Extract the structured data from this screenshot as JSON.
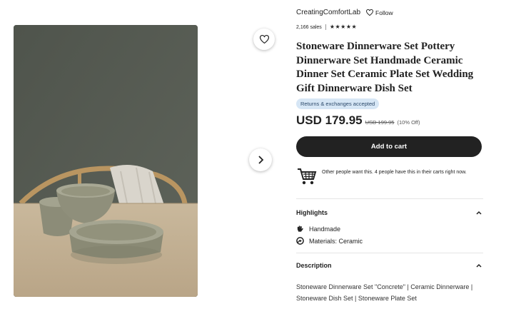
{
  "shop": {
    "name": "CreatingComfortLab",
    "follow_label": "Follow",
    "sales": "2,166 sales",
    "stars": "★★★★★"
  },
  "product": {
    "title": "Stoneware Dinnerware Set Pottery Dinnerware Set Handmade Ceramic Dinner Set Ceramic Plate Set Wedding Gift Dinnerware Dish Set",
    "badge": "Returns & exchanges accepted",
    "price": "USD 179.95",
    "old_price": "USD 199.95",
    "discount": "(10% Off)"
  },
  "actions": {
    "add_to_cart": "Add to cart"
  },
  "demand": {
    "bold": "Other people want this.",
    "text": " 4 people have this in their carts right now."
  },
  "highlights": {
    "title": "Highlights",
    "items": [
      {
        "label": "Handmade",
        "icon": "hand-icon"
      },
      {
        "label": "Materials: Ceramic",
        "icon": "materials-icon"
      }
    ]
  },
  "description": {
    "title": "Description",
    "text": "Stoneware Dinnerware Set \"Concrete\" | Ceramic Dinnerware | Stoneware Dish Set | Stoneware Plate Set"
  }
}
